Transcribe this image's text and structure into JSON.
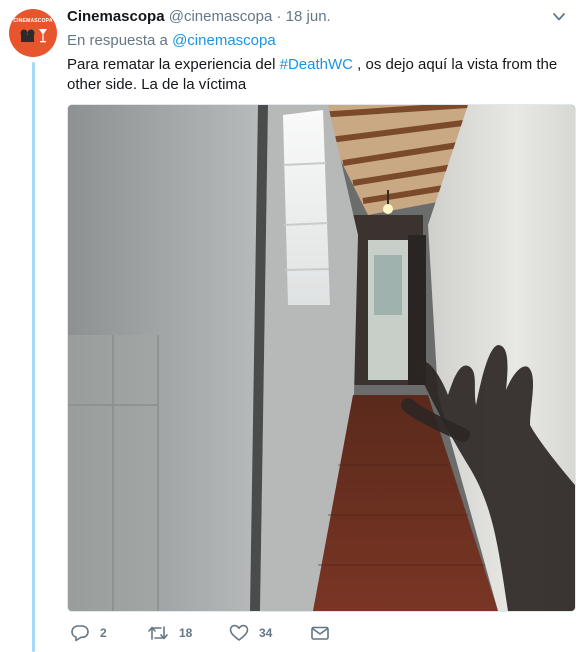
{
  "tweet": {
    "avatar_text": "CINEMASCOPA",
    "display_name": "Cinemascopa",
    "handle": "@cinemascopa",
    "separator": "·",
    "date": "18 jun.",
    "reply_prefix": "En respuesta a",
    "reply_mention": "@cinemascopa",
    "text_before": "Para rematar la experiencia del ",
    "hashtag": "#DeathWC",
    "text_after": " , os dejo aquí la vista from the other side. La de la víctima",
    "icons": {
      "caret": "chevron-down-icon",
      "reply": "reply-icon",
      "retweet": "retweet-icon",
      "like": "heart-icon",
      "dm": "envelope-icon"
    },
    "stats": {
      "replies": "2",
      "retweets": "18",
      "likes": "34"
    },
    "colors": {
      "link": "#1b95e0",
      "muted": "#657786",
      "thread": "#a4d9f6",
      "avatar_bg": "#e8552c"
    }
  }
}
